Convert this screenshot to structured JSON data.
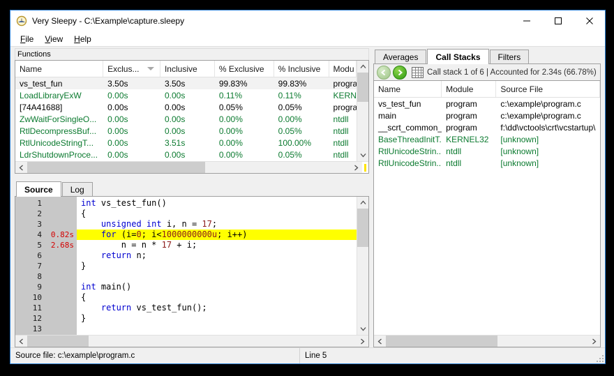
{
  "window": {
    "title": "Very Sleepy - C:\\Example\\capture.sleepy",
    "app_icon": "sleepy-clock-icon",
    "minimize_label": "─",
    "maximize_label": "□",
    "close_label": "✕"
  },
  "menu": [
    {
      "label": "File",
      "accel": "F"
    },
    {
      "label": "View",
      "accel": "V"
    },
    {
      "label": "Help",
      "accel": "H"
    }
  ],
  "functions_pane": {
    "caption": "Functions",
    "columns": [
      {
        "label": "Name",
        "sorted": false
      },
      {
        "label": "Exclus...",
        "sorted": true,
        "sort_dir": "desc"
      },
      {
        "label": "Inclusive",
        "sorted": false
      },
      {
        "label": "% Exclusive",
        "sorted": false
      },
      {
        "label": "% Inclusive",
        "sorted": false
      },
      {
        "label": "Modu",
        "sorted": false
      }
    ],
    "rows": [
      {
        "name": "vs_test_fun",
        "exclusive": "3.50s",
        "inclusive": "3.50s",
        "pct_exclusive": "99.83%",
        "pct_inclusive": "99.83%",
        "module": "progra",
        "color": "black",
        "selected": true
      },
      {
        "name": "LoadLibraryExW",
        "exclusive": "0.00s",
        "inclusive": "0.00s",
        "pct_exclusive": "0.11%",
        "pct_inclusive": "0.11%",
        "module": "KERNE",
        "color": "green",
        "selected": false
      },
      {
        "name": "[74A41688]",
        "exclusive": "0.00s",
        "inclusive": "0.00s",
        "pct_exclusive": "0.05%",
        "pct_inclusive": "0.05%",
        "module": "progra",
        "color": "black",
        "selected": false
      },
      {
        "name": "ZwWaitForSingleO...",
        "exclusive": "0.00s",
        "inclusive": "0.00s",
        "pct_exclusive": "0.00%",
        "pct_inclusive": "0.00%",
        "module": "ntdll",
        "color": "green",
        "selected": false
      },
      {
        "name": "RtlDecompressBuf...",
        "exclusive": "0.00s",
        "inclusive": "0.00s",
        "pct_exclusive": "0.00%",
        "pct_inclusive": "0.05%",
        "module": "ntdll",
        "color": "green",
        "selected": false
      },
      {
        "name": "RtlUnicodeStringT...",
        "exclusive": "0.00s",
        "inclusive": "3.51s",
        "pct_exclusive": "0.00%",
        "pct_inclusive": "100.00%",
        "module": "ntdll",
        "color": "green",
        "selected": false
      },
      {
        "name": "LdrShutdownProce...",
        "exclusive": "0.00s",
        "inclusive": "0.00s",
        "pct_exclusive": "0.00%",
        "pct_inclusive": "0.05%",
        "module": "ntdll",
        "color": "green",
        "selected": false
      }
    ]
  },
  "source_pane": {
    "tabs": [
      {
        "label": "Source",
        "active": true
      },
      {
        "label": "Log",
        "active": false
      }
    ],
    "lines": [
      {
        "num": "1",
        "time": "",
        "highlight": false,
        "tokens": [
          {
            "t": "int",
            "c": "kw"
          },
          {
            "t": " vs_test_fun()",
            "c": ""
          }
        ]
      },
      {
        "num": "2",
        "time": "",
        "highlight": false,
        "tokens": [
          {
            "t": "{",
            "c": ""
          }
        ]
      },
      {
        "num": "3",
        "time": "",
        "highlight": false,
        "tokens": [
          {
            "t": "    ",
            "c": ""
          },
          {
            "t": "unsigned int",
            "c": "kw"
          },
          {
            "t": " i, n = ",
            "c": ""
          },
          {
            "t": "17",
            "c": "num"
          },
          {
            "t": ";",
            "c": ""
          }
        ]
      },
      {
        "num": "4",
        "time": "0.82s",
        "highlight": true,
        "tokens": [
          {
            "t": "    ",
            "c": ""
          },
          {
            "t": "for",
            "c": "kw"
          },
          {
            "t": " (i=",
            "c": ""
          },
          {
            "t": "0",
            "c": "num"
          },
          {
            "t": "; i<",
            "c": ""
          },
          {
            "t": "1000000000u",
            "c": "num"
          },
          {
            "t": "; i++)",
            "c": ""
          }
        ]
      },
      {
        "num": "5",
        "time": "2.68s",
        "highlight": false,
        "tokens": [
          {
            "t": "        n = n * ",
            "c": ""
          },
          {
            "t": "17",
            "c": "num"
          },
          {
            "t": " + i;",
            "c": ""
          }
        ]
      },
      {
        "num": "6",
        "time": "",
        "highlight": false,
        "tokens": [
          {
            "t": "    ",
            "c": ""
          },
          {
            "t": "return",
            "c": "kw"
          },
          {
            "t": " n;",
            "c": ""
          }
        ]
      },
      {
        "num": "7",
        "time": "",
        "highlight": false,
        "tokens": [
          {
            "t": "}",
            "c": ""
          }
        ]
      },
      {
        "num": "8",
        "time": "",
        "highlight": false,
        "tokens": [
          {
            "t": "",
            "c": ""
          }
        ]
      },
      {
        "num": "9",
        "time": "",
        "highlight": false,
        "tokens": [
          {
            "t": "int",
            "c": "kw"
          },
          {
            "t": " main()",
            "c": ""
          }
        ]
      },
      {
        "num": "10",
        "time": "",
        "highlight": false,
        "tokens": [
          {
            "t": "{",
            "c": ""
          }
        ]
      },
      {
        "num": "11",
        "time": "",
        "highlight": false,
        "tokens": [
          {
            "t": "    ",
            "c": ""
          },
          {
            "t": "return",
            "c": "kw"
          },
          {
            "t": " vs_test_fun();",
            "c": ""
          }
        ]
      },
      {
        "num": "12",
        "time": "",
        "highlight": false,
        "tokens": [
          {
            "t": "}",
            "c": ""
          }
        ]
      },
      {
        "num": "13",
        "time": "",
        "highlight": false,
        "tokens": [
          {
            "t": "",
            "c": ""
          }
        ]
      }
    ]
  },
  "right_panel": {
    "tabs": [
      {
        "label": "Averages",
        "active": false
      },
      {
        "label": "Call Stacks",
        "active": true
      },
      {
        "label": "Filters",
        "active": false
      }
    ],
    "toolbar": {
      "back_icon": "back-arrow-icon",
      "forward_icon": "forward-arrow-icon",
      "grid_icon": "grid-icon",
      "status": "Call stack 1 of 6 | Accounted for 2.34s (66.78%)"
    },
    "columns": [
      {
        "label": "Name"
      },
      {
        "label": "Module"
      },
      {
        "label": "Source File"
      }
    ],
    "rows": [
      {
        "name": "vs_test_fun",
        "module": "program",
        "source": "c:\\example\\program.c",
        "color": "black"
      },
      {
        "name": "main",
        "module": "program",
        "source": "c:\\example\\program.c",
        "color": "black"
      },
      {
        "name": "__scrt_common_...",
        "module": "program",
        "source": "f:\\dd\\vctools\\crt\\vcstartup\\",
        "color": "black"
      },
      {
        "name": "BaseThreadInitT...",
        "module": "KERNEL32",
        "source": "[unknown]",
        "color": "green"
      },
      {
        "name": "RtlUnicodeStrin...",
        "module": "ntdll",
        "source": "[unknown]",
        "color": "green"
      },
      {
        "name": "RtlUnicodeStrin...",
        "module": "ntdll",
        "source": "[unknown]",
        "color": "green"
      }
    ]
  },
  "statusbar": {
    "source_file": "Source file: c:\\example\\program.c",
    "line": "Line 5"
  },
  "colors": {
    "accent_border": "#2a7fd4",
    "function_green": "#0b7a2f",
    "highlight_yellow": "#ffff00",
    "time_red": "#d40000",
    "keyword_blue": "#0000d0",
    "number_maroon": "#8b1a1a",
    "gutter_gray": "#c8c8c8"
  }
}
